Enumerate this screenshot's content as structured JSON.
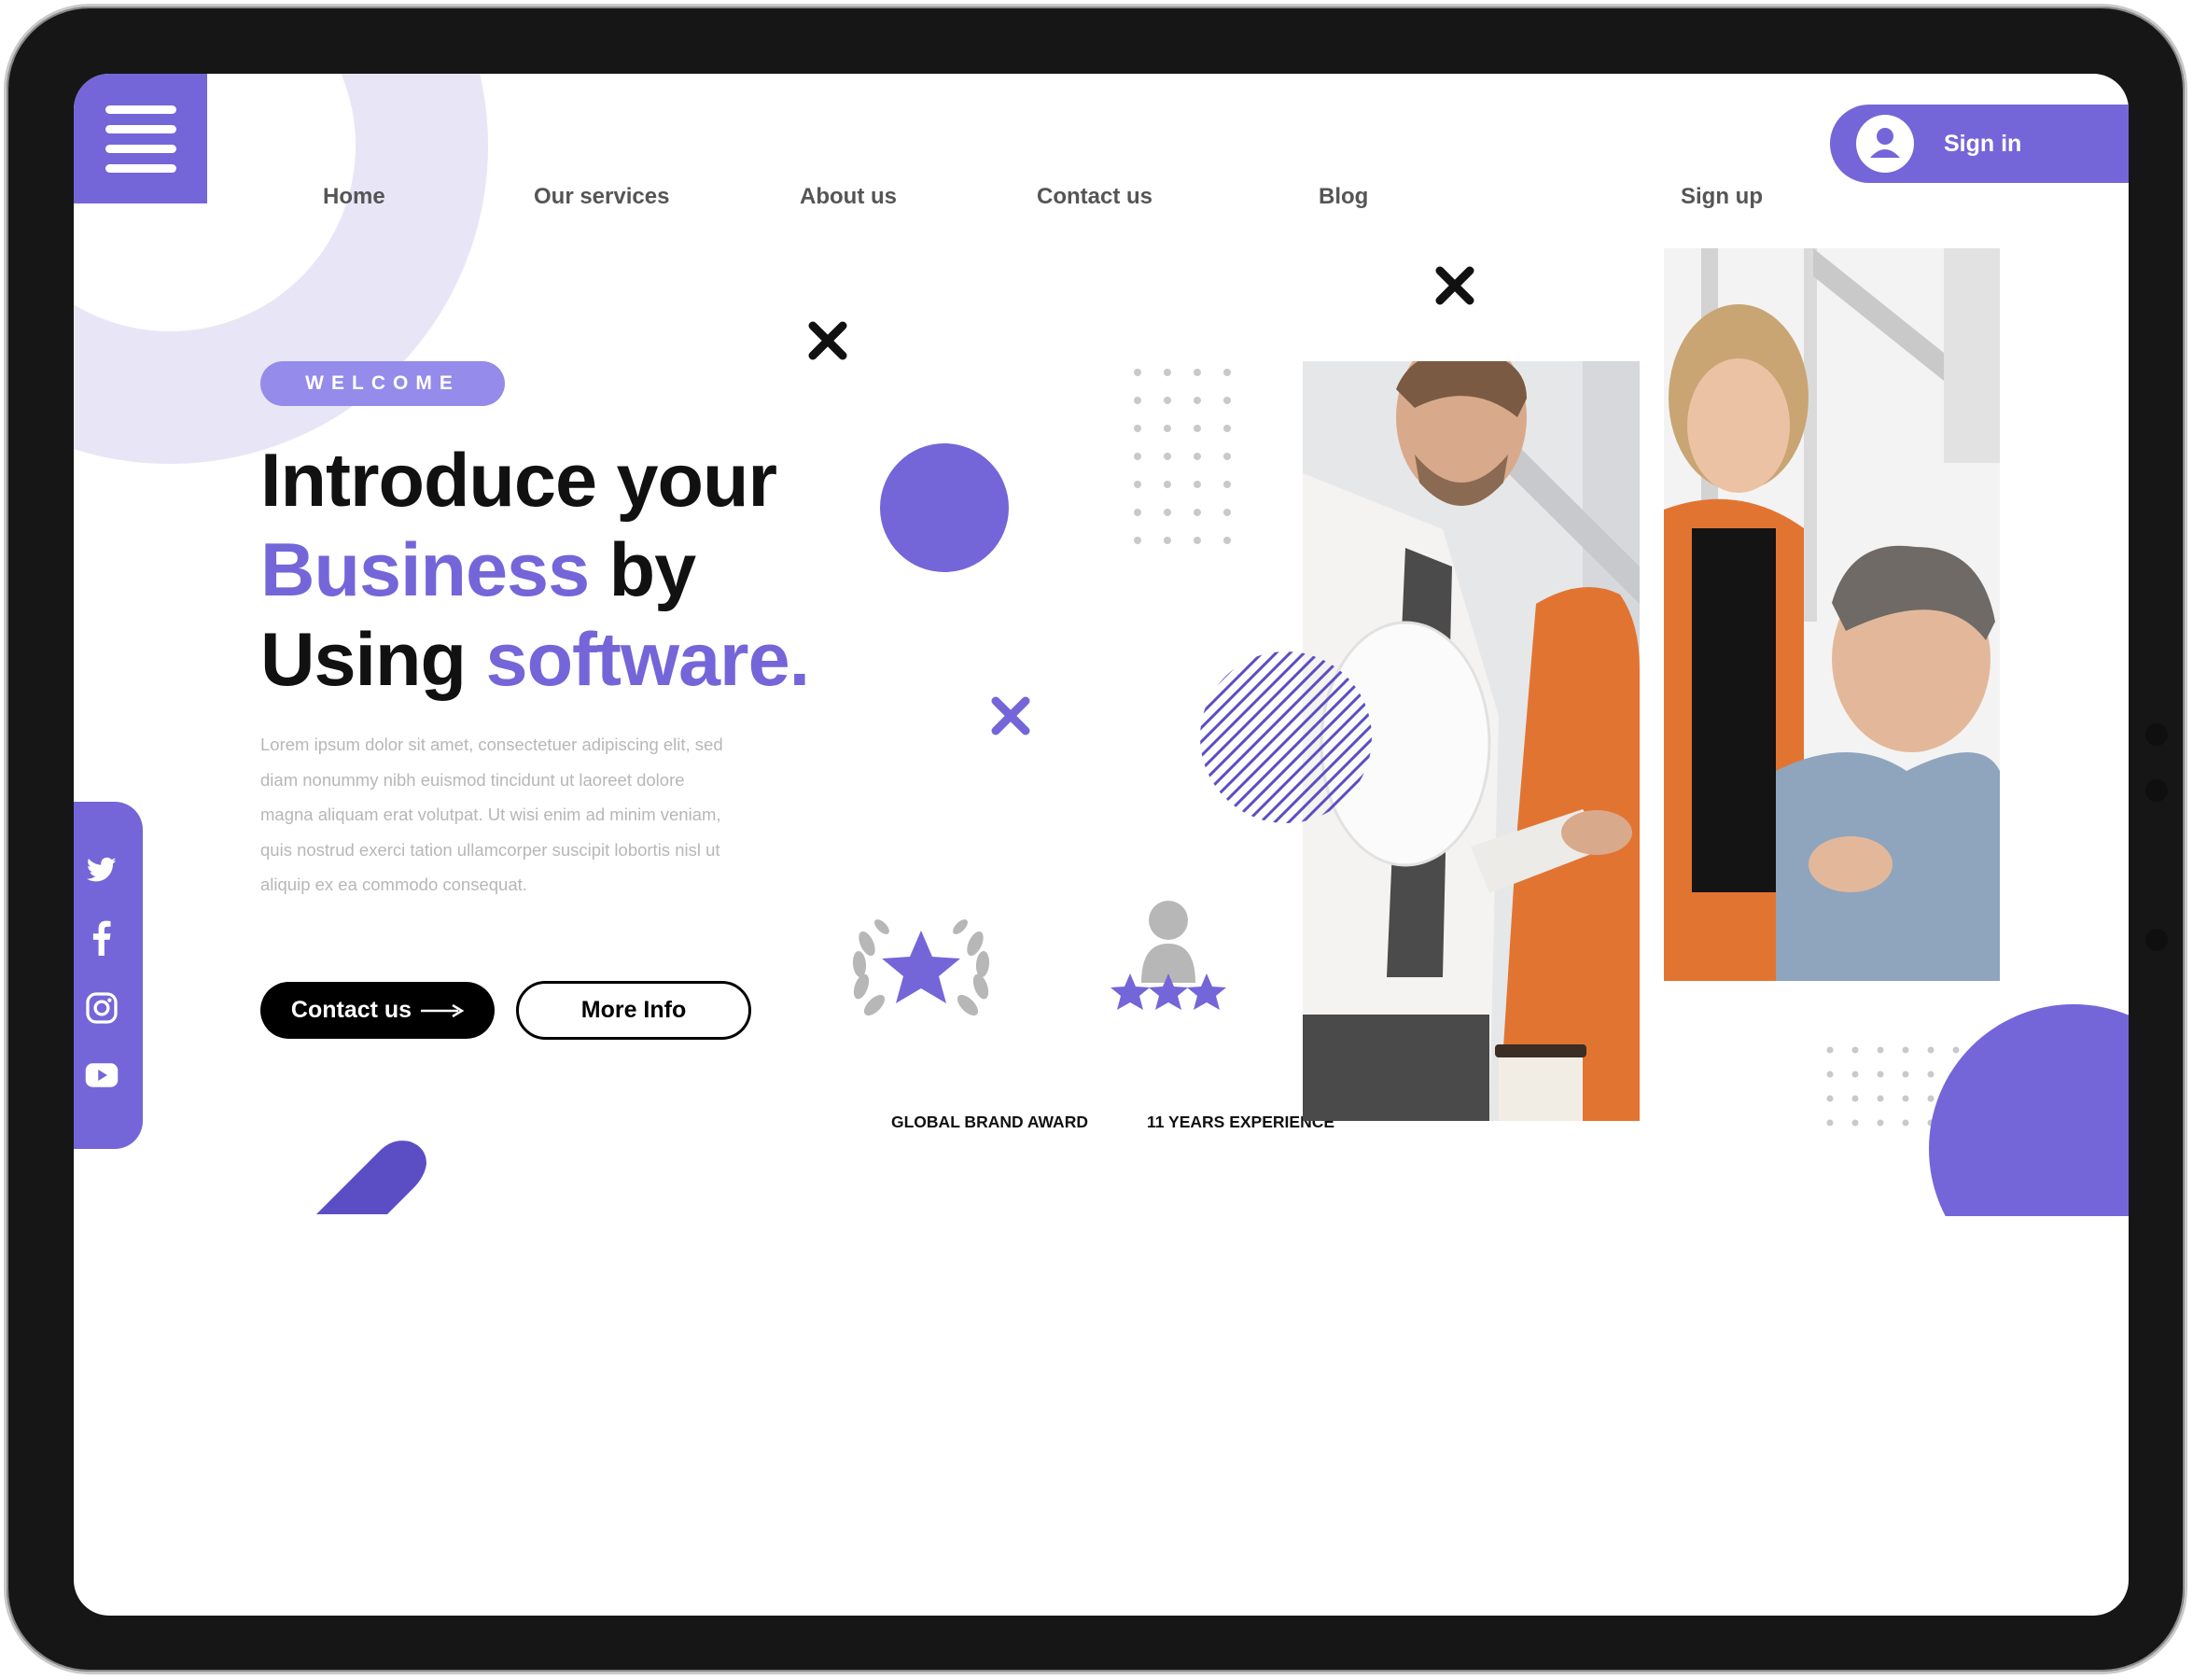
{
  "nav": {
    "items": [
      {
        "label": "Home"
      },
      {
        "label": "Our services"
      },
      {
        "label": "About us"
      },
      {
        "label": "Contact us"
      },
      {
        "label": "Blog"
      }
    ],
    "signup_label": "Sign up",
    "signin_label": "Sign in"
  },
  "hero": {
    "badge": "WELCOME",
    "line1": "Introduce your",
    "line2_accent": "Business",
    "line2_rest": " by",
    "line3_start": "Using ",
    "line3_accent": "software.",
    "body_lines": [
      "Lorem ipsum dolor sit amet, consectetuer adipiscing elit, sed",
      "diam nonummy nibh euismod tincidunt ut laoreet dolore",
      "magna aliquam erat volutpat. Ut wisi enim ad minim veniam,",
      "quis nostrud exerci tation ullamcorper suscipit lobortis nisl ut",
      "aliquip ex ea commodo consequat."
    ],
    "contact_button": "Contact us",
    "more_button": "More Info"
  },
  "awards": {
    "brand_label": "GLOBAL BRAND AWARD",
    "experience_label": "11 YEARS EXPERIENCE"
  },
  "social": {
    "icons": [
      "twitter-icon",
      "facebook-icon",
      "instagram-icon",
      "youtube-icon"
    ]
  },
  "colors": {
    "accent": "#7466d8",
    "accent_light": "#948bea",
    "ring": "#e8e6f6",
    "dark": "#111111",
    "muted_text": "#b7b7b7"
  }
}
